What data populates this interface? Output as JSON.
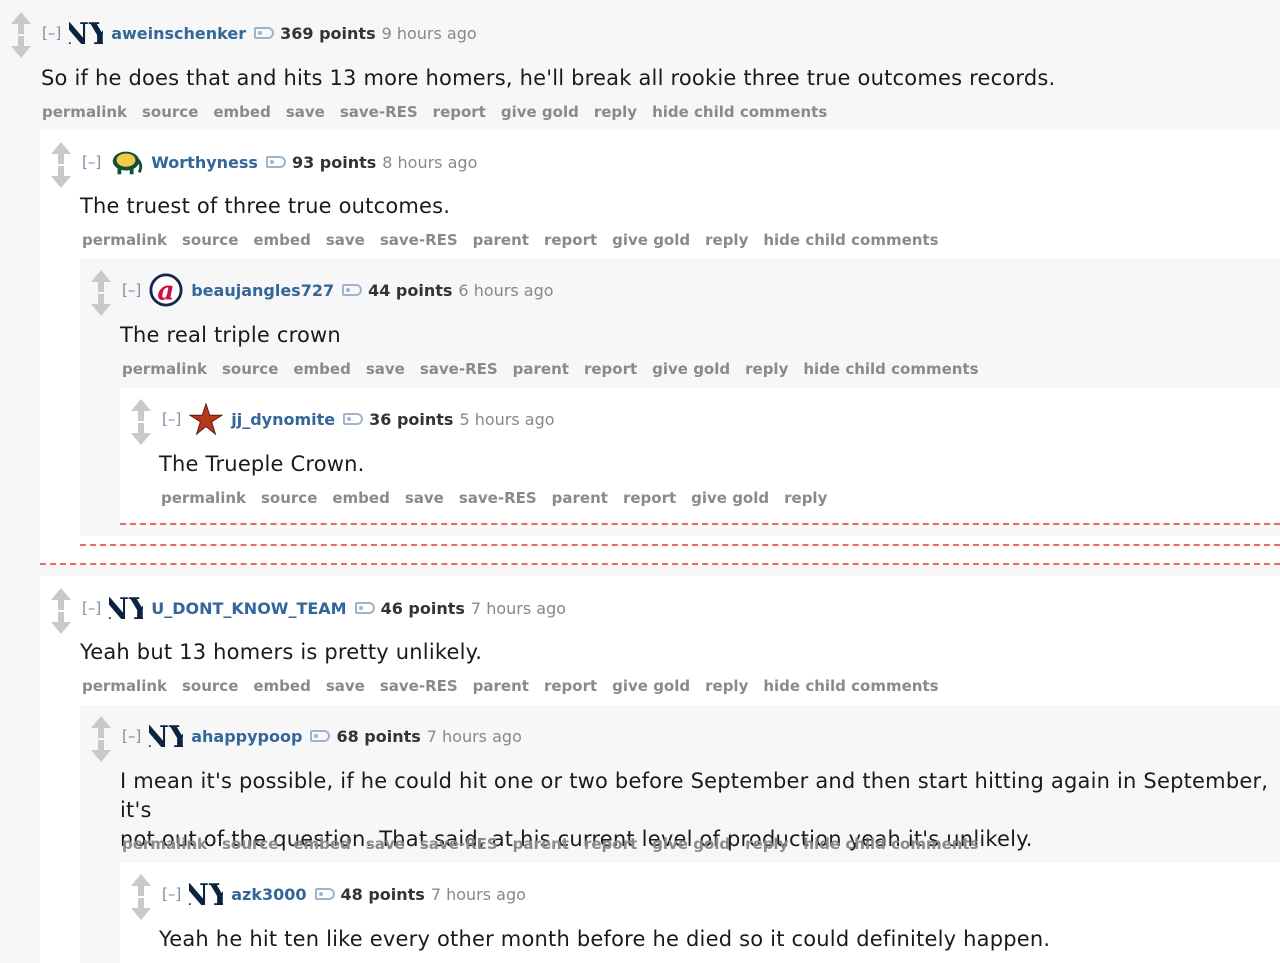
{
  "btn": {
    "permalink": "permalink",
    "source": "source",
    "embed": "embed",
    "save": "save",
    "save_res": "save-RES",
    "parent": "parent",
    "report": "report",
    "give_gold": "give gold",
    "reply": "reply",
    "hide_child": "hide child comments"
  },
  "comments": {
    "c1": {
      "toggle": "[–]",
      "author": "aweinschenker",
      "score": "369 points",
      "time": "9 hours ago",
      "body": "So if he does that and hits 13 more homers, he'll break all rookie three true outcomes records."
    },
    "c2": {
      "toggle": "[–]",
      "author": "Worthyness",
      "score": "93 points",
      "time": "8 hours ago",
      "body": "The truest of three true outcomes."
    },
    "c3": {
      "toggle": "[–]",
      "author": "beaujangles727",
      "score": "44 points",
      "time": "6 hours ago",
      "body": "The real triple crown"
    },
    "c4": {
      "toggle": "[–]",
      "author": "jj_dynomite",
      "score": "36 points",
      "time": "5 hours ago",
      "body": "The Trueple Crown."
    },
    "c5": {
      "toggle": "[–]",
      "author": "U_DONT_KNOW_TEAM",
      "score": "46 points",
      "time": "7 hours ago",
      "body": "Yeah but 13 homers is pretty unlikely."
    },
    "c6": {
      "toggle": "[–]",
      "author": "ahappypoop",
      "score": "68 points",
      "time": "7 hours ago",
      "body_line1": "I mean it's possible, if he could hit one or two before September and then start hitting again in September, it's",
      "body_line2": "not out of the question. That said, at his current level of production yeah it's unlikely."
    },
    "c7": {
      "toggle": "[–]",
      "author": "azk3000",
      "score": "48 points",
      "time": "7 hours ago",
      "body": "Yeah he hit ten like every other month before he died so it could definitely happen."
    }
  },
  "flair_icons": {
    "c1": "yankees-logo-icon",
    "c2": "athletics-elephant-icon",
    "c3": "braves-a-logo-icon",
    "c4": "astros-star-icon",
    "c5": "yankees-logo-icon",
    "c6": "yankees-logo-icon",
    "c7": "yankees-logo-icon"
  },
  "colors": {
    "author": "#336699",
    "collapse_line": "#e66666",
    "button_text": "#8a8a8a"
  }
}
